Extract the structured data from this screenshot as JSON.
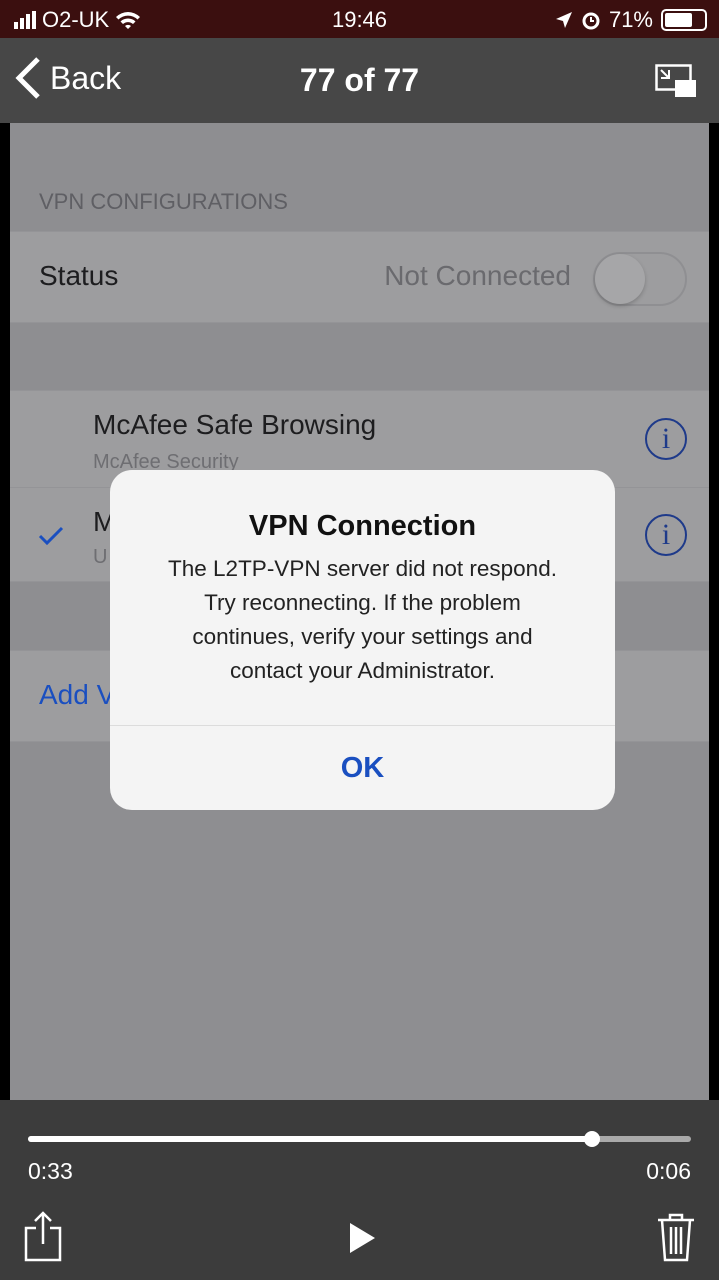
{
  "status_bar": {
    "carrier": "O2-UK",
    "time": "19:46",
    "battery": "71%",
    "battery_level": 0.71,
    "icons": [
      "signal-icon",
      "wifi-icon",
      "location-icon",
      "alarm-icon",
      "battery-icon"
    ]
  },
  "nav": {
    "back_label": "Back",
    "title": "77 of 77",
    "pip_icon": "picture-in-picture-icon"
  },
  "settings": {
    "section_header": "VPN CONFIGURATIONS",
    "status_label": "Status",
    "status_value": "Not Connected",
    "status_toggle_on": false,
    "vpns": [
      {
        "name": "McAfee Safe Browsing",
        "subtitle": "McAfee Security",
        "selected": false
      },
      {
        "name": "M",
        "subtitle": "U",
        "selected": true
      }
    ],
    "add_vpn": "Add V"
  },
  "dialog": {
    "title": "VPN Connection",
    "lines": [
      "The L2TP-VPN server did not respond.",
      "Try reconnecting. If the problem",
      "continues, verify your settings and",
      "contact your Administrator."
    ],
    "ok": "OK"
  },
  "player": {
    "elapsed": "0:33",
    "remaining": "0:06",
    "progress": 0.85,
    "icons": [
      "share-icon",
      "play-icon",
      "trash-icon"
    ]
  },
  "colors": {
    "accent": "#1a4fc0",
    "status_bar": "#3b0f0f"
  }
}
